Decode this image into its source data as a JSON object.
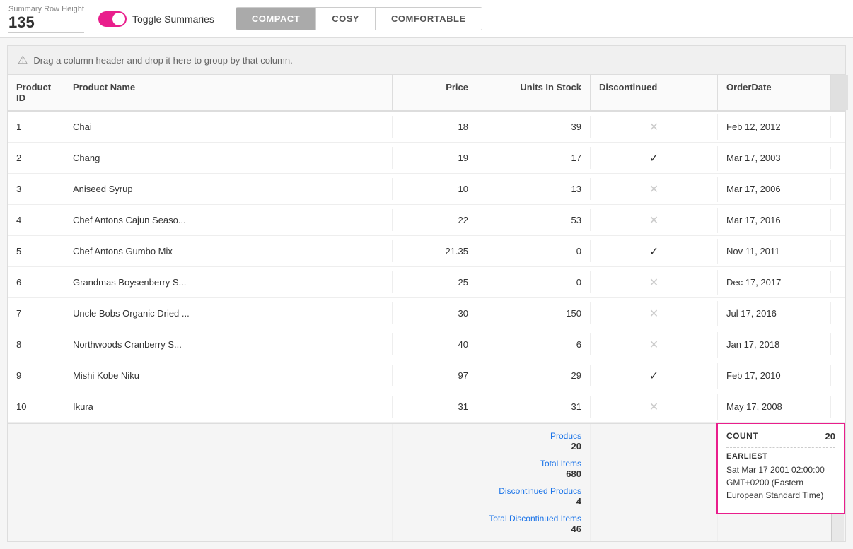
{
  "topBar": {
    "rowHeightLabel": "Summary Row Height",
    "rowHeightValue": "135",
    "toggleLabel": "Toggle Summaries",
    "toggleActive": true,
    "viewButtons": [
      {
        "id": "compact",
        "label": "COMPACT",
        "active": true
      },
      {
        "id": "cosy",
        "label": "COSY",
        "active": false
      },
      {
        "id": "comfortable",
        "label": "COMFORTABLE",
        "active": false
      }
    ]
  },
  "groupDropZone": {
    "text": "Drag a column header and drop it here to group by that column."
  },
  "columns": [
    {
      "id": "productId",
      "label": "Product ID",
      "align": "left"
    },
    {
      "id": "productName",
      "label": "Product Name",
      "align": "left"
    },
    {
      "id": "price",
      "label": "Price",
      "align": "right"
    },
    {
      "id": "unitsInStock",
      "label": "Units In Stock",
      "align": "right"
    },
    {
      "id": "discontinued",
      "label": "Discontinued",
      "align": "center"
    },
    {
      "id": "orderDate",
      "label": "OrderDate",
      "align": "left"
    }
  ],
  "rows": [
    {
      "id": 1,
      "name": "Chai",
      "price": "18",
      "units": "39",
      "discontinued": false,
      "date": "Feb 12, 2012"
    },
    {
      "id": 2,
      "name": "Chang",
      "price": "19",
      "units": "17",
      "discontinued": true,
      "date": "Mar 17, 2003"
    },
    {
      "id": 3,
      "name": "Aniseed Syrup",
      "price": "10",
      "units": "13",
      "discontinued": false,
      "date": "Mar 17, 2006"
    },
    {
      "id": 4,
      "name": "Chef Antons Cajun Seaso...",
      "price": "22",
      "units": "53",
      "discontinued": false,
      "date": "Mar 17, 2016"
    },
    {
      "id": 5,
      "name": "Chef Antons Gumbo Mix",
      "price": "21.35",
      "units": "0",
      "discontinued": true,
      "date": "Nov 11, 2011"
    },
    {
      "id": 6,
      "name": "Grandmas Boysenberry S...",
      "price": "25",
      "units": "0",
      "discontinued": false,
      "date": "Dec 17, 2017"
    },
    {
      "id": 7,
      "name": "Uncle Bobs Organic Dried ...",
      "price": "30",
      "units": "150",
      "discontinued": false,
      "date": "Jul 17, 2016"
    },
    {
      "id": 8,
      "name": "Northwoods Cranberry S...",
      "price": "40",
      "units": "6",
      "discontinued": false,
      "date": "Jan 17, 2018"
    },
    {
      "id": 9,
      "name": "Mishi Kobe Niku",
      "price": "97",
      "units": "29",
      "discontinued": true,
      "date": "Feb 17, 2010"
    },
    {
      "id": 10,
      "name": "Ikura",
      "price": "31",
      "units": "31",
      "discontinued": false,
      "date": "May 17, 2008"
    }
  ],
  "footer": {
    "summaries": [
      {
        "label": "Producs",
        "value": "20"
      },
      {
        "label": "Total Items",
        "value": "680"
      },
      {
        "label": "Discontinued Producs",
        "value": "4"
      },
      {
        "label": "Total Discontinued Items",
        "value": "46"
      }
    ],
    "popup": {
      "countLabel": "COUNT",
      "countValue": "20",
      "earliestLabel": "EARLIEST",
      "earliestValue": "Sat Mar 17 2001 02:00:00 GMT+0200 (Eastern European Standard Time)"
    }
  }
}
